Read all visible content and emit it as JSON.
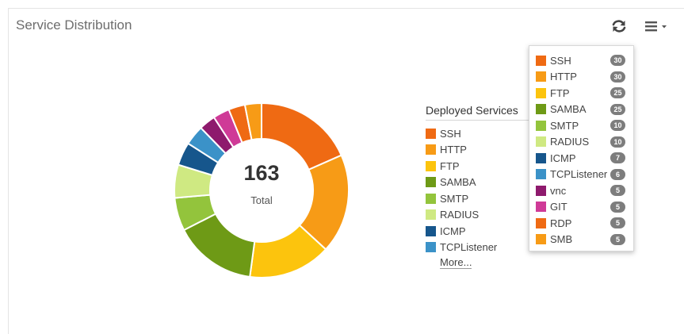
{
  "panel": {
    "title": "Service Distribution",
    "refresh_icon": "refresh-icon",
    "menu_icon": "hamburger-menu-icon"
  },
  "chart_data": {
    "type": "pie",
    "donut": true,
    "center_value": "163",
    "center_label": "Total",
    "legend_title": "Deployed Services",
    "legend_placement": "right",
    "legend_more": "More...",
    "categories": [
      "SSH",
      "HTTP",
      "FTP",
      "SAMBA",
      "SMTP",
      "RADIUS",
      "ICMP",
      "TCPListener",
      "vnc",
      "GIT",
      "RDP",
      "SMB"
    ],
    "values": [
      30,
      30,
      25,
      25,
      10,
      10,
      7,
      6,
      5,
      5,
      5,
      5
    ],
    "badges": [
      "30",
      "30",
      "25",
      "25",
      "10",
      "10",
      "7",
      "6",
      "5",
      "5",
      "5",
      "5"
    ],
    "colors": [
      "#ef6a13",
      "#f79b16",
      "#fcc40d",
      "#6e9a16",
      "#93c43c",
      "#cfe982",
      "#16568c",
      "#3b92c8",
      "#8e1a6d",
      "#cf3a97",
      "#ef6a13",
      "#f79b16"
    ],
    "legend_visible_count": 8
  }
}
